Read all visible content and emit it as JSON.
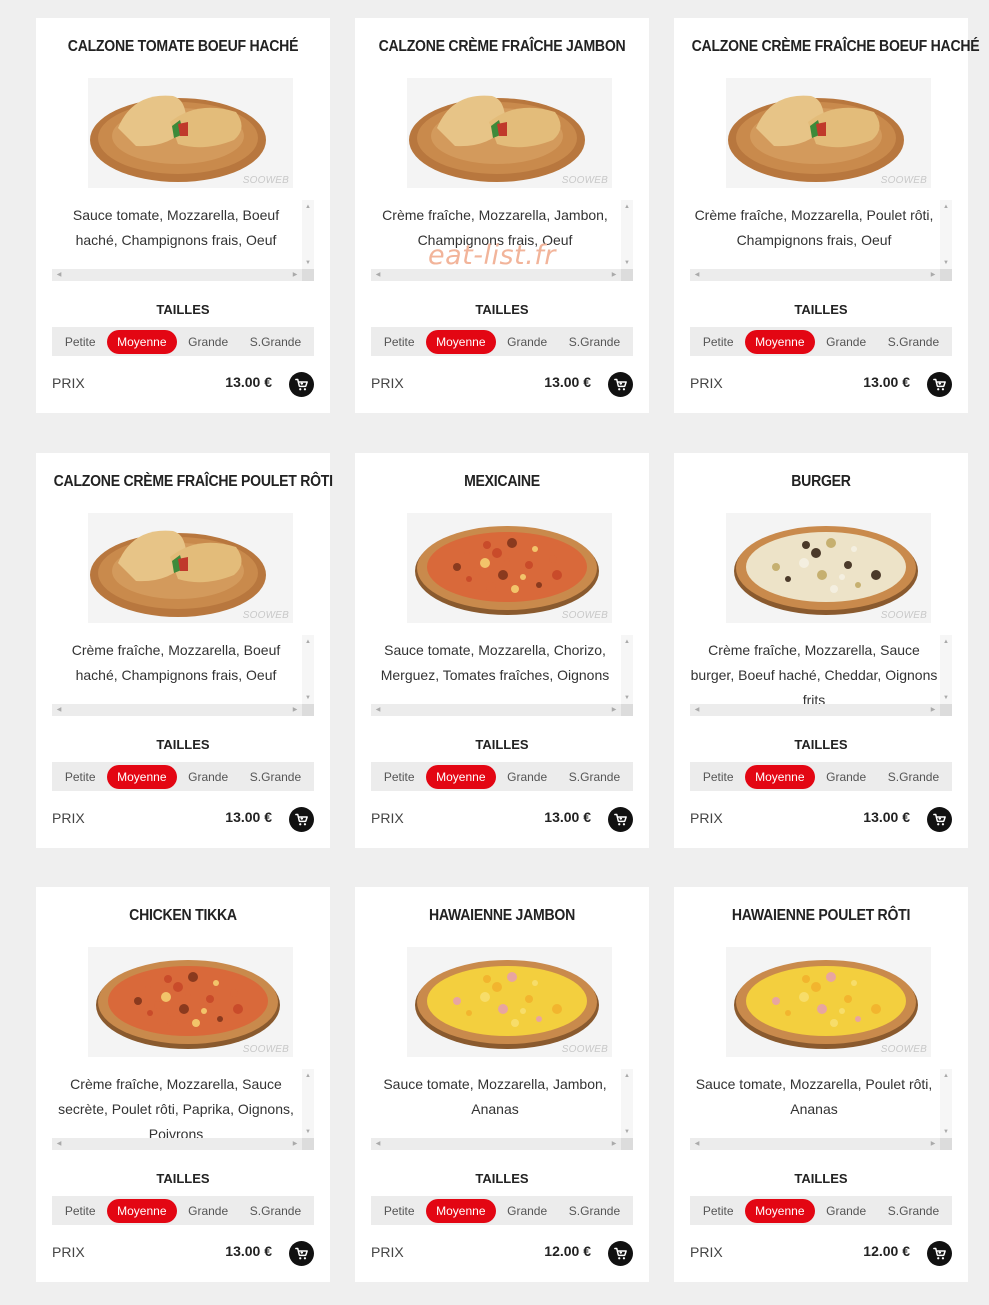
{
  "watermark": "eat-list.fr",
  "photo_watermark": "SOOWEB",
  "labels": {
    "tailles": "TAILLES",
    "prix": "PRIX"
  },
  "sizes": [
    "Petite",
    "Moyenne",
    "Grande",
    "S.Grande"
  ],
  "active_size_index": 1,
  "accent_color": "#e30613",
  "products": [
    {
      "name": "CALZONE TOMATE BOEUF HACHÉ",
      "description": "Sauce tomate, Mozzarella, Boeuf haché, Champignons frais, Oeuf",
      "price": "13.00 €",
      "image": "calzone"
    },
    {
      "name": "CALZONE CRÈME FRAÎCHE JAMBON",
      "description": "Crème fraîche, Mozzarella, Jambon, Champignons frais, Oeuf",
      "price": "13.00 €",
      "image": "calzone"
    },
    {
      "name": "CALZONE CRÈME FRAÎCHE BOEUF HACHÉ",
      "description": "Crème fraîche, Mozzarella, Poulet rôti, Champignons frais, Oeuf",
      "price": "13.00 €",
      "image": "calzone"
    },
    {
      "name": "CALZONE CRÈME FRAÎCHE POULET RÔTI",
      "description": "Crème fraîche, Mozzarella, Boeuf haché, Champignons frais, Oeuf",
      "price": "13.00 €",
      "image": "calzone"
    },
    {
      "name": "MEXICAINE",
      "description": "Sauce tomate, Mozzarella, Chorizo, Merguez, Tomates fraîches, Oignons",
      "price": "13.00 €",
      "image": "pizza-red"
    },
    {
      "name": "BURGER",
      "description": "Crème fraîche, Mozzarella, Sauce burger, Boeuf haché, Cheddar, Oignons frits",
      "price": "13.00 €",
      "image": "pizza-white"
    },
    {
      "name": "CHICKEN TIKKA",
      "description": "Crème fraîche, Mozzarella, Sauce secrète, Poulet rôti, Paprika, Oignons, Poivrons",
      "price": "13.00 €",
      "image": "pizza-red"
    },
    {
      "name": "HAWAIENNE JAMBON",
      "description": "Sauce tomate, Mozzarella, Jambon, Ananas",
      "price": "12.00 €",
      "image": "pizza-yellow"
    },
    {
      "name": "HAWAIENNE POULET RÔTI",
      "description": "Sauce tomate, Mozzarella, Poulet rôti, Ananas",
      "price": "12.00 €",
      "image": "pizza-yellow"
    }
  ]
}
